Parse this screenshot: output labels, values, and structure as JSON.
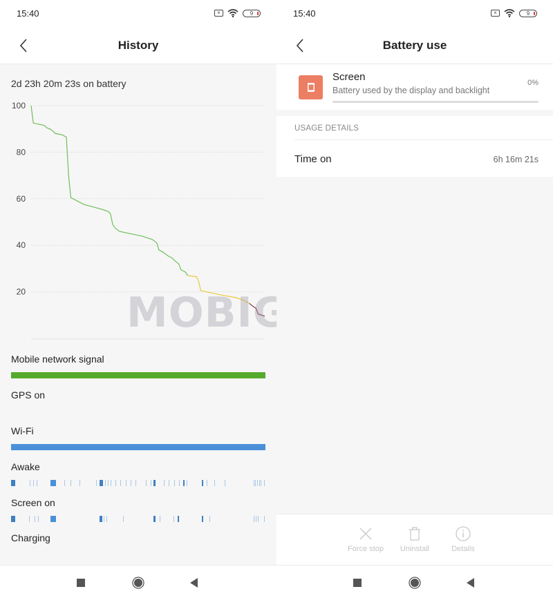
{
  "left": {
    "status": {
      "time": "15:40",
      "sim_icon": "sim-x-icon",
      "wifi_icon": "wifi-icon",
      "battery_level": "9"
    },
    "header": {
      "title": "History",
      "back_icon": "chevron-left-icon"
    },
    "duration": "2d 23h 20m 23s on battery",
    "chart_data": {
      "type": "line",
      "title": "",
      "xlabel": "",
      "ylabel": "",
      "ylim": [
        0,
        100
      ],
      "yticks": [
        100,
        80,
        60,
        40,
        20
      ],
      "grid": true,
      "x_unit": "fraction of time on battery",
      "series": [
        {
          "name": "battery-high",
          "color": "#6fbf5a",
          "points": [
            [
              0.0,
              100
            ],
            [
              0.01,
              92.5
            ],
            [
              0.06,
              91.5
            ],
            [
              0.07,
              90.5
            ],
            [
              0.085,
              90
            ],
            [
              0.1,
              89
            ],
            [
              0.11,
              88
            ],
            [
              0.14,
              87.5
            ],
            [
              0.15,
              87
            ],
            [
              0.16,
              86.5
            ],
            [
              0.17,
              70
            ],
            [
              0.18,
              60.5
            ],
            [
              0.21,
              59
            ],
            [
              0.24,
              57.5
            ],
            [
              0.28,
              56.5
            ],
            [
              0.32,
              55.5
            ],
            [
              0.35,
              54.5
            ],
            [
              0.36,
              53.5
            ],
            [
              0.37,
              49
            ],
            [
              0.38,
              47.5
            ],
            [
              0.4,
              46
            ],
            [
              0.45,
              45
            ],
            [
              0.5,
              44
            ],
            [
              0.55,
              42.5
            ],
            [
              0.57,
              41
            ],
            [
              0.58,
              38
            ],
            [
              0.6,
              37
            ],
            [
              0.62,
              35.5
            ],
            [
              0.64,
              34.5
            ],
            [
              0.65,
              33.5
            ],
            [
              0.67,
              32
            ],
            [
              0.68,
              29.5
            ],
            [
              0.7,
              28.5
            ],
            [
              0.71,
              27
            ]
          ]
        },
        {
          "name": "battery-medium",
          "color": "#e8c83a",
          "points": [
            [
              0.71,
              27
            ],
            [
              0.75,
              26.5
            ],
            [
              0.76,
              24.5
            ],
            [
              0.77,
              20.5
            ],
            [
              0.82,
              19.5
            ],
            [
              0.87,
              18.5
            ],
            [
              0.93,
              17.5
            ],
            [
              0.96,
              16.5
            ],
            [
              0.99,
              15
            ]
          ]
        },
        {
          "name": "battery-low",
          "color": "#8a3b4a",
          "points": [
            [
              0.99,
              15
            ],
            [
              1.01,
              13.5
            ],
            [
              1.02,
              13
            ],
            [
              1.03,
              10.5
            ],
            [
              1.06,
              9.5
            ]
          ]
        }
      ]
    },
    "tracks": [
      {
        "label": "Mobile network signal",
        "type": "bar",
        "color": "#55aa2e",
        "value": 1.0
      },
      {
        "label": "GPS on",
        "type": "none"
      },
      {
        "label": "Wi-Fi",
        "type": "bar",
        "color": "#4a90d9",
        "value": 1.0
      },
      {
        "label": "Awake",
        "type": "ticks",
        "color": "#4a90d9",
        "ticks": [
          [
            0.0,
            0.015,
            "dark"
          ],
          [
            0.074,
            0.002
          ],
          [
            0.087,
            0.002
          ],
          [
            0.1,
            0.002
          ],
          [
            0.155,
            0.023,
            "solid"
          ],
          [
            0.21,
            0.002
          ],
          [
            0.235,
            0.002
          ],
          [
            0.27,
            0.002
          ],
          [
            0.334,
            0.002
          ],
          [
            0.348,
            0.014,
            "dark"
          ],
          [
            0.37,
            0.002
          ],
          [
            0.38,
            0.002
          ],
          [
            0.392,
            0.002
          ],
          [
            0.41,
            0.002
          ],
          [
            0.43,
            0.002
          ],
          [
            0.45,
            0.002
          ],
          [
            0.47,
            0.002
          ],
          [
            0.49,
            0.002
          ],
          [
            0.53,
            0.002
          ],
          [
            0.55,
            0.002
          ],
          [
            0.56,
            0.007,
            "dark"
          ],
          [
            0.6,
            0.002
          ],
          [
            0.62,
            0.002
          ],
          [
            0.64,
            0.002
          ],
          [
            0.66,
            0.002
          ],
          [
            0.677,
            0.004,
            "dark"
          ],
          [
            0.69,
            0.002
          ],
          [
            0.75,
            0.006,
            "dark"
          ],
          [
            0.77,
            0.002
          ],
          [
            0.8,
            0.002
          ],
          [
            0.84,
            0.002
          ],
          [
            0.953,
            0.002
          ],
          [
            0.96,
            0.002
          ],
          [
            0.967,
            0.002
          ],
          [
            0.975,
            0.002
          ],
          [
            0.982,
            0.002
          ],
          [
            0.995,
            0.002
          ]
        ]
      },
      {
        "label": "Screen on",
        "type": "ticks",
        "color": "#4a90d9",
        "ticks": [
          [
            0.0,
            0.015,
            "dark"
          ],
          [
            0.072,
            0.002
          ],
          [
            0.092,
            0.002
          ],
          [
            0.107,
            0.002
          ],
          [
            0.155,
            0.023,
            "solid"
          ],
          [
            0.348,
            0.012,
            "dark"
          ],
          [
            0.365,
            0.002
          ],
          [
            0.375,
            0.002
          ],
          [
            0.44,
            0.002
          ],
          [
            0.56,
            0.007,
            "dark"
          ],
          [
            0.585,
            0.002
          ],
          [
            0.638,
            0.002
          ],
          [
            0.655,
            0.004,
            "dark"
          ],
          [
            0.75,
            0.006,
            "dark"
          ],
          [
            0.78,
            0.002
          ],
          [
            0.953,
            0.002
          ],
          [
            0.962,
            0.002
          ],
          [
            0.97,
            0.002
          ],
          [
            0.995,
            0.002
          ]
        ]
      },
      {
        "label": "Charging",
        "type": "none"
      }
    ],
    "watermark": "MOBIGYAAN",
    "nav": {
      "recent_icon": "square-icon",
      "home_icon": "circle-icon",
      "back_icon": "triangle-back-icon"
    }
  },
  "right": {
    "status": {
      "time": "15:40",
      "sim_icon": "sim-x-icon",
      "wifi_icon": "wifi-icon",
      "battery_level": "9"
    },
    "header": {
      "title": "Battery use",
      "back_icon": "chevron-left-icon"
    },
    "app": {
      "name": "Screen",
      "description": "Battery used by the display and backlight",
      "percent": "0%",
      "usage_fraction": 0.0,
      "icon_color": "#ec7e63"
    },
    "usage_details": {
      "header": "USAGE DETAILS",
      "rows": [
        {
          "label": "Time on",
          "value": "6h 16m 21s"
        }
      ]
    },
    "actions": [
      {
        "label": "Force stop",
        "icon": "close-icon",
        "enabled": false
      },
      {
        "label": "Uninstall",
        "icon": "trash-icon",
        "enabled": false
      },
      {
        "label": "Details",
        "icon": "info-icon",
        "enabled": false
      }
    ],
    "nav": {
      "recent_icon": "square-icon",
      "home_icon": "circle-icon",
      "back_icon": "triangle-back-icon"
    }
  }
}
